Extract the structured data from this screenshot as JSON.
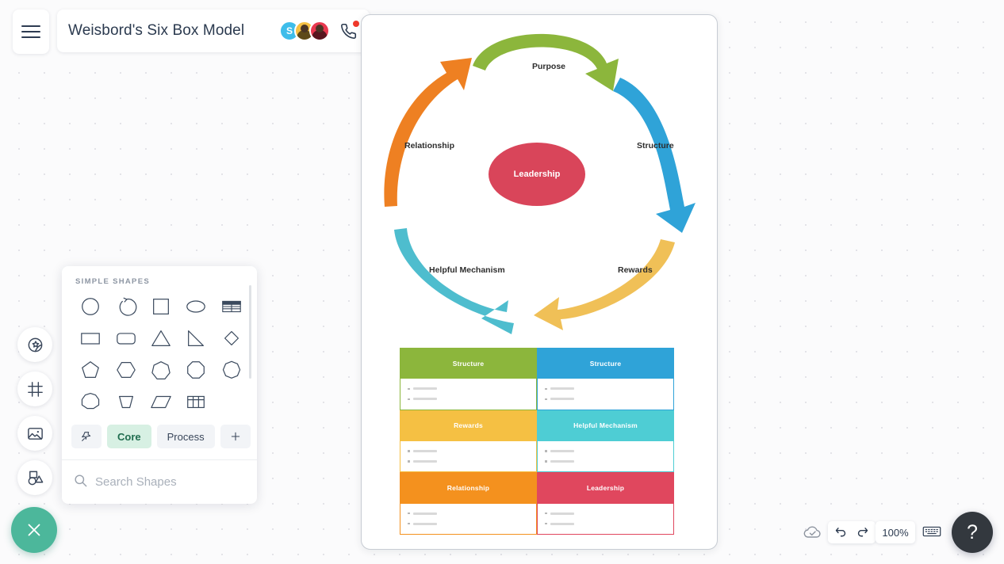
{
  "app": {
    "document_title": "Weisbord's Six Box Model",
    "menu_icon": "hamburger-menu-icon",
    "phone_icon": "phone-call-icon",
    "collaborators": [
      {
        "initial": "S",
        "color": "#3ebdea",
        "type": "initial"
      },
      {
        "initial": "",
        "color": "#f5c043",
        "type": "photo"
      },
      {
        "initial": "",
        "color": "#e8384f",
        "type": "photo"
      }
    ]
  },
  "diagram": {
    "center": {
      "label": "Leadership",
      "color": "#d9455a"
    },
    "arrows": [
      {
        "label": "Purpose",
        "color": "#8cb63c"
      },
      {
        "label": "Structure",
        "color": "#2fa3d8"
      },
      {
        "label": "Rewards",
        "color": "#f0c057"
      },
      {
        "label": "Helpful Mechanism",
        "color": "#4ebdce"
      },
      {
        "label": "Relationship",
        "color": "#ee8022"
      }
    ],
    "matrix": [
      {
        "title": "Structure",
        "color": "#8cb63c",
        "bullets": [
          "",
          ""
        ]
      },
      {
        "title": "Rewards",
        "color": "#f5c043",
        "bullets": [
          "",
          ""
        ]
      },
      {
        "title": "Relationship",
        "color": "#f4911e",
        "bullets": [
          "",
          ""
        ]
      },
      {
        "title": "Structure",
        "color": "#2fa3d8",
        "bullets": [
          "",
          ""
        ]
      },
      {
        "title": "Helpful Mechanism",
        "color": "#4ecdd4",
        "bullets": [
          "",
          ""
        ]
      },
      {
        "title": "Leadership",
        "color": "#e0475e",
        "bullets": [
          "",
          ""
        ]
      }
    ]
  },
  "left_rail": {
    "items": [
      {
        "name": "theme-sticker-icon"
      },
      {
        "name": "frame-grid-icon"
      },
      {
        "name": "image-icon"
      },
      {
        "name": "shapes-icon"
      }
    ],
    "close": {
      "name": "close-x-icon",
      "color": "#4cb79b"
    }
  },
  "shapes_panel": {
    "section_title": "SIMPLE SHAPES",
    "shapes": [
      "circle",
      "arc-arrow",
      "square",
      "ellipse",
      "table-lines",
      "rectangle",
      "rounded-rectangle",
      "triangle",
      "right-triangle",
      "diamond",
      "pentagon",
      "hexagon",
      "heptagon",
      "octagon",
      "nonagon",
      "decagon",
      "trapezoid",
      "parallelogram",
      "grid-table"
    ],
    "tabs": [
      {
        "label": "",
        "icon": "pin-icon",
        "active": false
      },
      {
        "label": "Core",
        "active": true
      },
      {
        "label": "Process",
        "active": false
      },
      {
        "label": "+",
        "icon": "plus-icon",
        "active": false
      }
    ],
    "search": {
      "placeholder": "Search Shapes",
      "value": "",
      "icon": "search-icon"
    },
    "more_icon": "kebab-menu-icon"
  },
  "statusbar": {
    "cloud_icon": "cloud-saved-icon",
    "undo_icon": "undo-arrow-icon",
    "redo_icon": "redo-arrow-icon",
    "zoom_level": "100%",
    "keyboard_icon": "keyboard-shortcuts-icon",
    "help_label": "?"
  }
}
